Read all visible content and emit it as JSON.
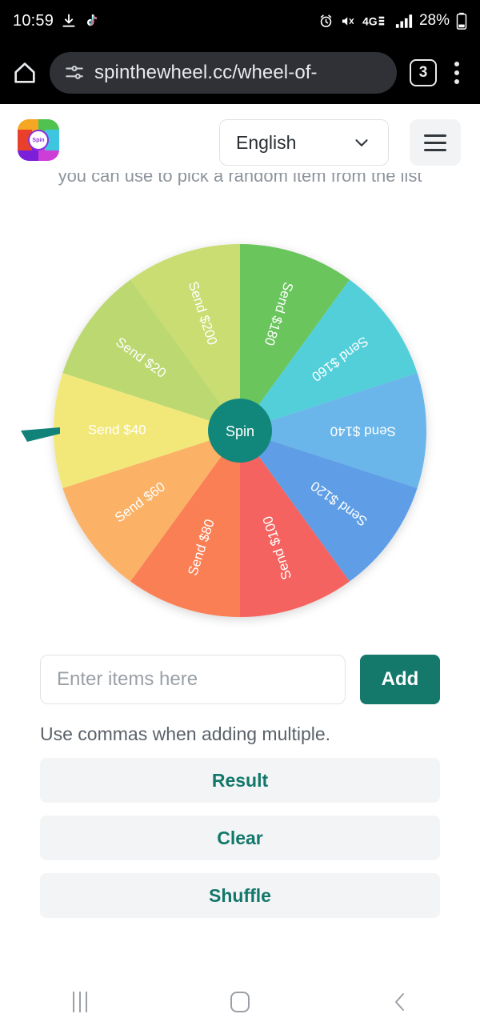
{
  "status_bar": {
    "clock": "10:59",
    "battery_percent": "28%",
    "network": "4G",
    "icons": [
      "download-icon",
      "tiktok-icon",
      "alarm-icon",
      "mute-icon",
      "signal-icon",
      "battery-icon"
    ]
  },
  "browser": {
    "url": "spinthewheel.cc/wheel-of-",
    "tab_count": "3",
    "home_icon": "home-icon",
    "site_info_icon": "permissions-icon",
    "menu_icon": "overflow-menu-icon"
  },
  "site": {
    "logo_text": "Spin",
    "language": "English",
    "menu_icon": "hamburger-icon",
    "tagline": "you can use to pick a random item from the list"
  },
  "wheel": {
    "spin_label": "Spin",
    "pointer_color": "#11827a",
    "hub_color": "#11877b",
    "segments": [
      {
        "label": "Send $180",
        "color": "#6bc55d"
      },
      {
        "label": "Send $160",
        "color": "#52cfda"
      },
      {
        "label": "Send $140",
        "color": "#6ab6ea"
      },
      {
        "label": "Send $120",
        "color": "#5e9ee6"
      },
      {
        "label": "Send $100",
        "color": "#f4645f"
      },
      {
        "label": "Send $80",
        "color": "#fa7f54"
      },
      {
        "label": "Send $60",
        "color": "#fbb166"
      },
      {
        "label": "Send $40",
        "color": "#f2e879"
      },
      {
        "label": "Send $20",
        "color": "#bcd86f"
      },
      {
        "label": "Send $200",
        "color": "#c9dd72"
      }
    ]
  },
  "controls": {
    "input_placeholder": "Enter items here",
    "input_value": "",
    "add_label": "Add",
    "hint": "Use commas when adding multiple.",
    "result_label": "Result",
    "clear_label": "Clear",
    "shuffle_label": "Shuffle"
  },
  "nav_bar": {
    "recents_icon": "recents-icon",
    "home_icon": "home-icon",
    "back_icon": "back-icon"
  }
}
